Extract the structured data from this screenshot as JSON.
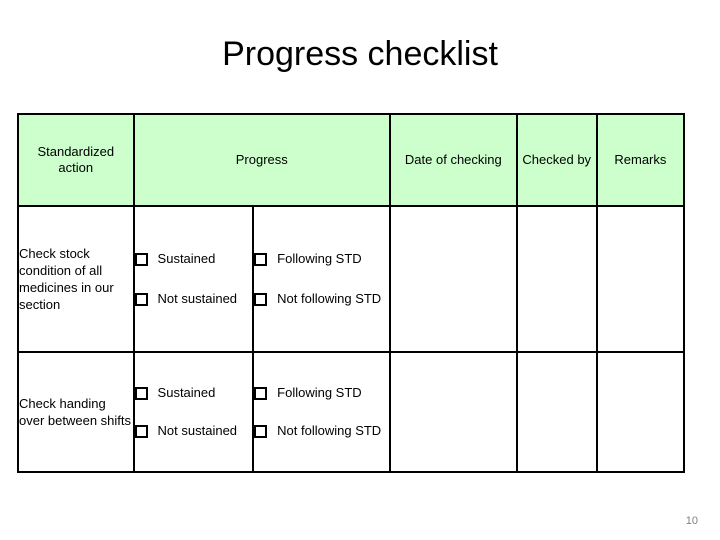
{
  "slide": {
    "title": "Progress checklist",
    "page_number": "10",
    "accent_header_color": "#ccffcc",
    "border_color": "#000000",
    "page_number_color": "#808080"
  },
  "table": {
    "headers": {
      "standardized_action": "Standardized action",
      "progress": "Progress",
      "date_of_checking": "Date of checking",
      "checked_by": "Checked by",
      "remarks": "Remarks"
    },
    "rows": [
      {
        "action": "Check stock condition of all medicines in our section",
        "progress_options_a": [
          "Sustained",
          "Not sustained"
        ],
        "progress_options_b": [
          "Following STD",
          "Not following STD"
        ],
        "date_of_checking": "",
        "checked_by": "",
        "remarks": ""
      },
      {
        "action": "Check handing over between shifts",
        "progress_options_a": [
          "Sustained",
          "Not sustained"
        ],
        "progress_options_b": [
          "Following STD",
          "Not following STD"
        ],
        "date_of_checking": "",
        "checked_by": "",
        "remarks": ""
      }
    ]
  }
}
